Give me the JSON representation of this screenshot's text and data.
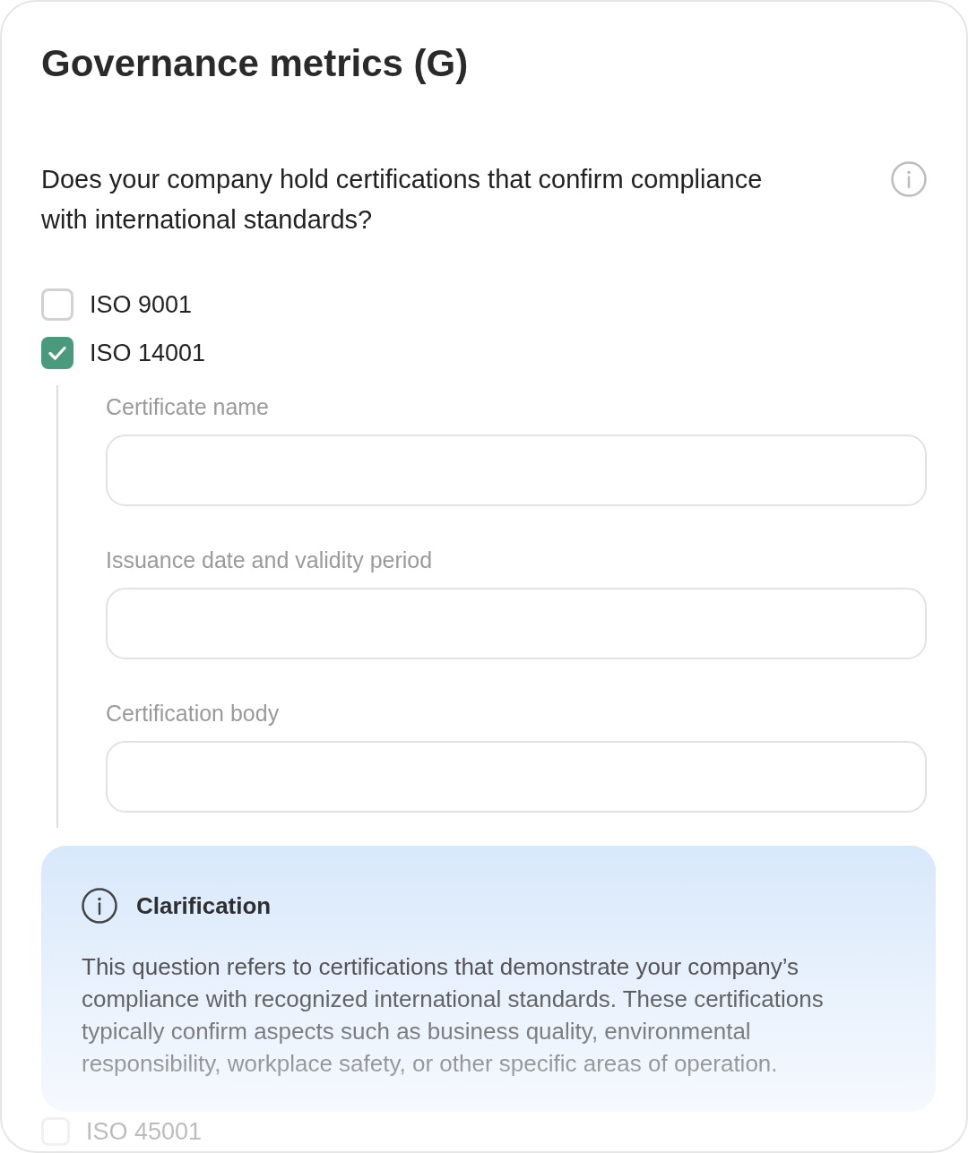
{
  "title": "Governance metrics (G)",
  "question": {
    "text": "Does your company hold certifications that confirm compliance with international standards?"
  },
  "options": [
    {
      "label": "ISO 9001",
      "checked": false
    },
    {
      "label": "ISO 14001",
      "checked": true,
      "fields": [
        {
          "label": "Certificate name"
        },
        {
          "label": "Issuance date and validity period"
        },
        {
          "label": "Certification body"
        }
      ]
    }
  ],
  "clarification": {
    "title": "Clarification",
    "text": "This question refers to certifications that demonstrate your company’s compliance with recognized international standards. These certifications typically confirm aspects such as business quality, environmental responsibility, workplace safety, or other specific areas of operation."
  },
  "more_options": [
    {
      "label": "ISO 45001",
      "checked": false
    }
  ]
}
